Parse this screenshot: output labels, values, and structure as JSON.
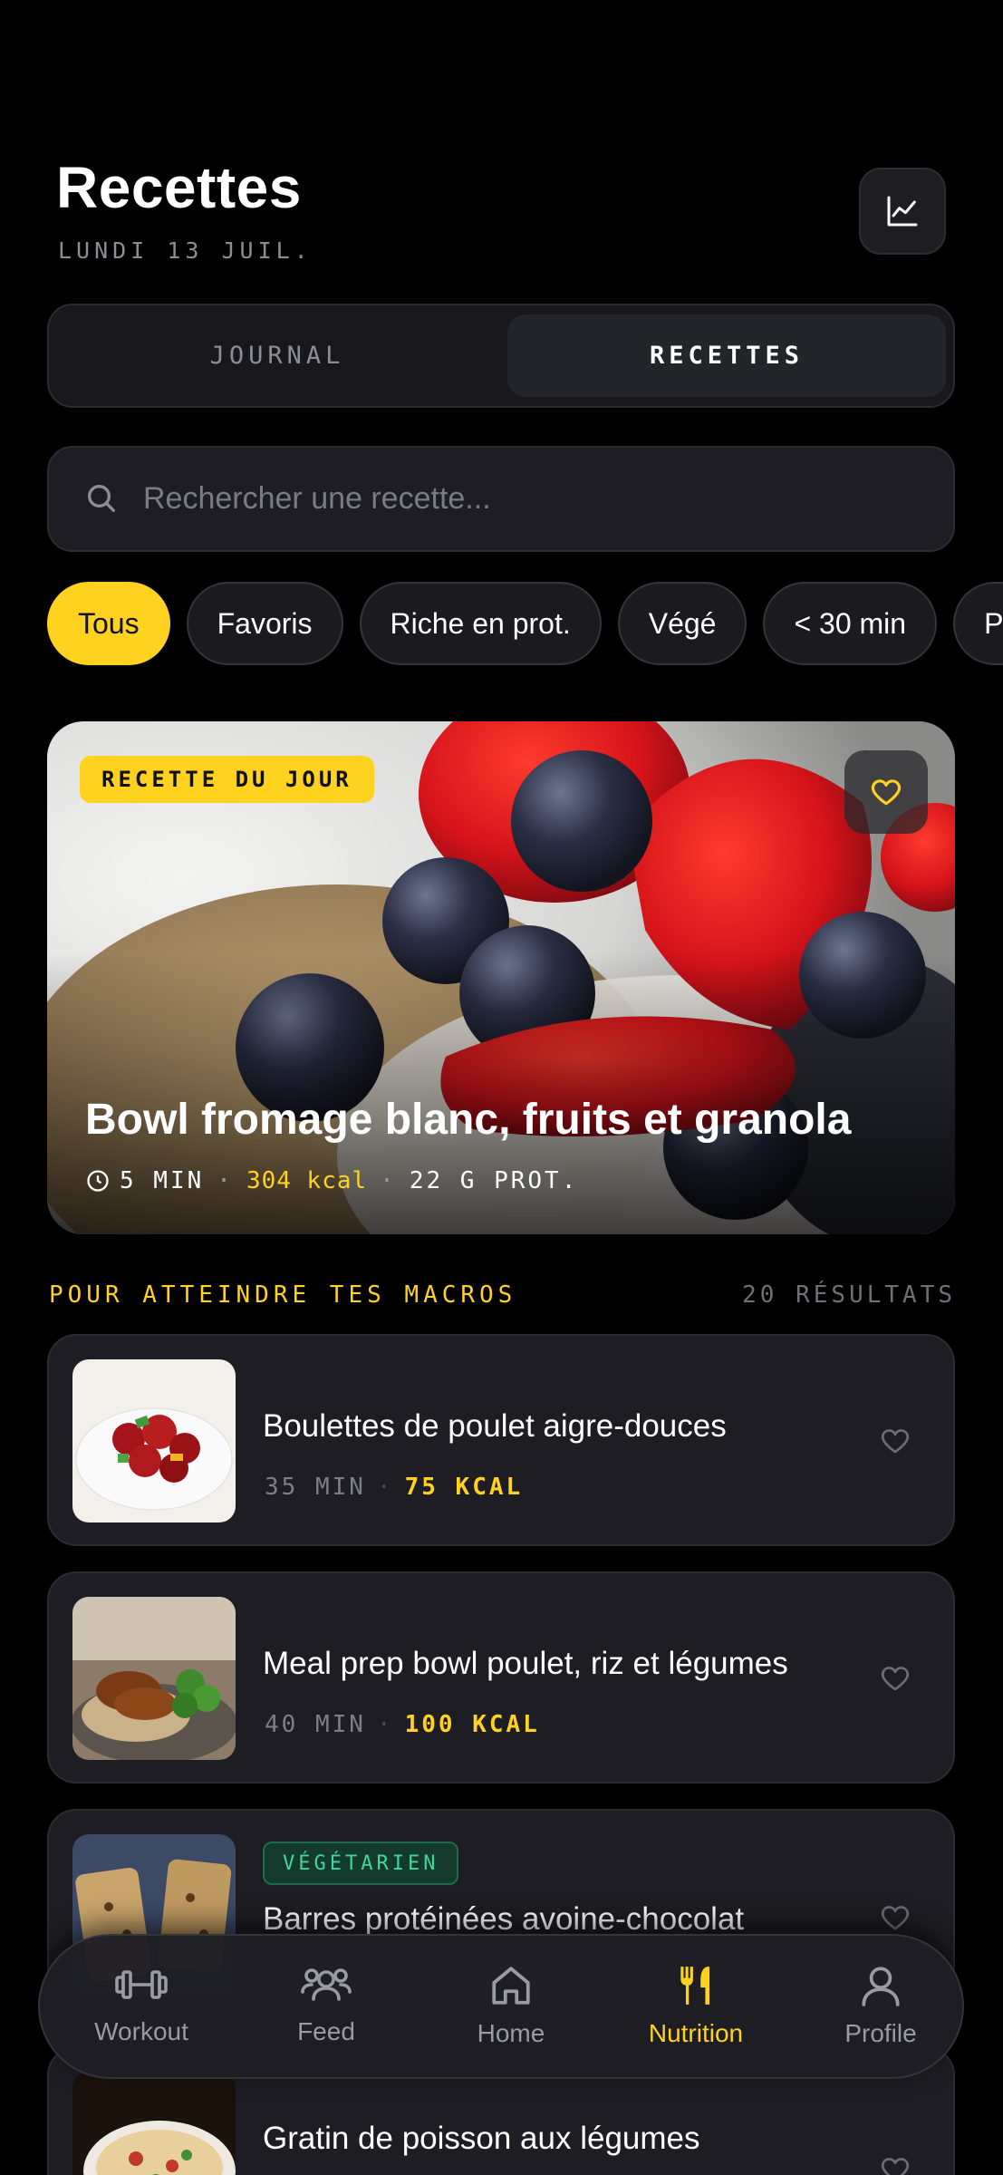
{
  "header": {
    "title": "Recettes",
    "date": "LUNDI 13 JUIL."
  },
  "segments": {
    "journal": "JOURNAL",
    "recipes": "RECETTES",
    "active": "recipes"
  },
  "search": {
    "placeholder": "Rechercher une recette..."
  },
  "filters": [
    {
      "label": "Tous",
      "active": true
    },
    {
      "label": "Favoris",
      "active": false
    },
    {
      "label": "Riche en prot.",
      "active": false
    },
    {
      "label": "Végé",
      "active": false
    },
    {
      "label": "< 30 min",
      "active": false
    },
    {
      "label": "Pe",
      "active": false
    }
  ],
  "hero": {
    "badge": "RECETTE DU JOUR",
    "title": "Bowl fromage blanc, fruits et granola",
    "time": "5 MIN",
    "kcal": "304 kcal",
    "protein": "22 G PROT."
  },
  "section": {
    "title": "POUR ATTEINDRE TES MACROS",
    "count": "20 RÉSULTATS"
  },
  "recipes": [
    {
      "name": "Boulettes de poulet aigre-douces",
      "time": "35 MIN",
      "kcal": "75 KCAL"
    },
    {
      "name": "Meal prep bowl poulet, riz et légumes",
      "time": "40 MIN",
      "kcal": "100 KCAL"
    },
    {
      "name": "Barres protéinées avoine-chocolat",
      "badge": "VÉGÉTARIEN"
    },
    {
      "name": "Gratin de poisson aux légumes"
    }
  ],
  "nav": [
    {
      "label": "Workout",
      "icon": "dumbbell-icon"
    },
    {
      "label": "Feed",
      "icon": "users-icon"
    },
    {
      "label": "Home",
      "icon": "home-icon"
    },
    {
      "label": "Nutrition",
      "icon": "fork-knife-icon",
      "active": true
    },
    {
      "label": "Profile",
      "icon": "user-icon"
    }
  ],
  "colors": {
    "accent": "#ffd21f",
    "background": "#000000",
    "surface": "#1d1d23",
    "vegetarian": "#3ed79a"
  }
}
